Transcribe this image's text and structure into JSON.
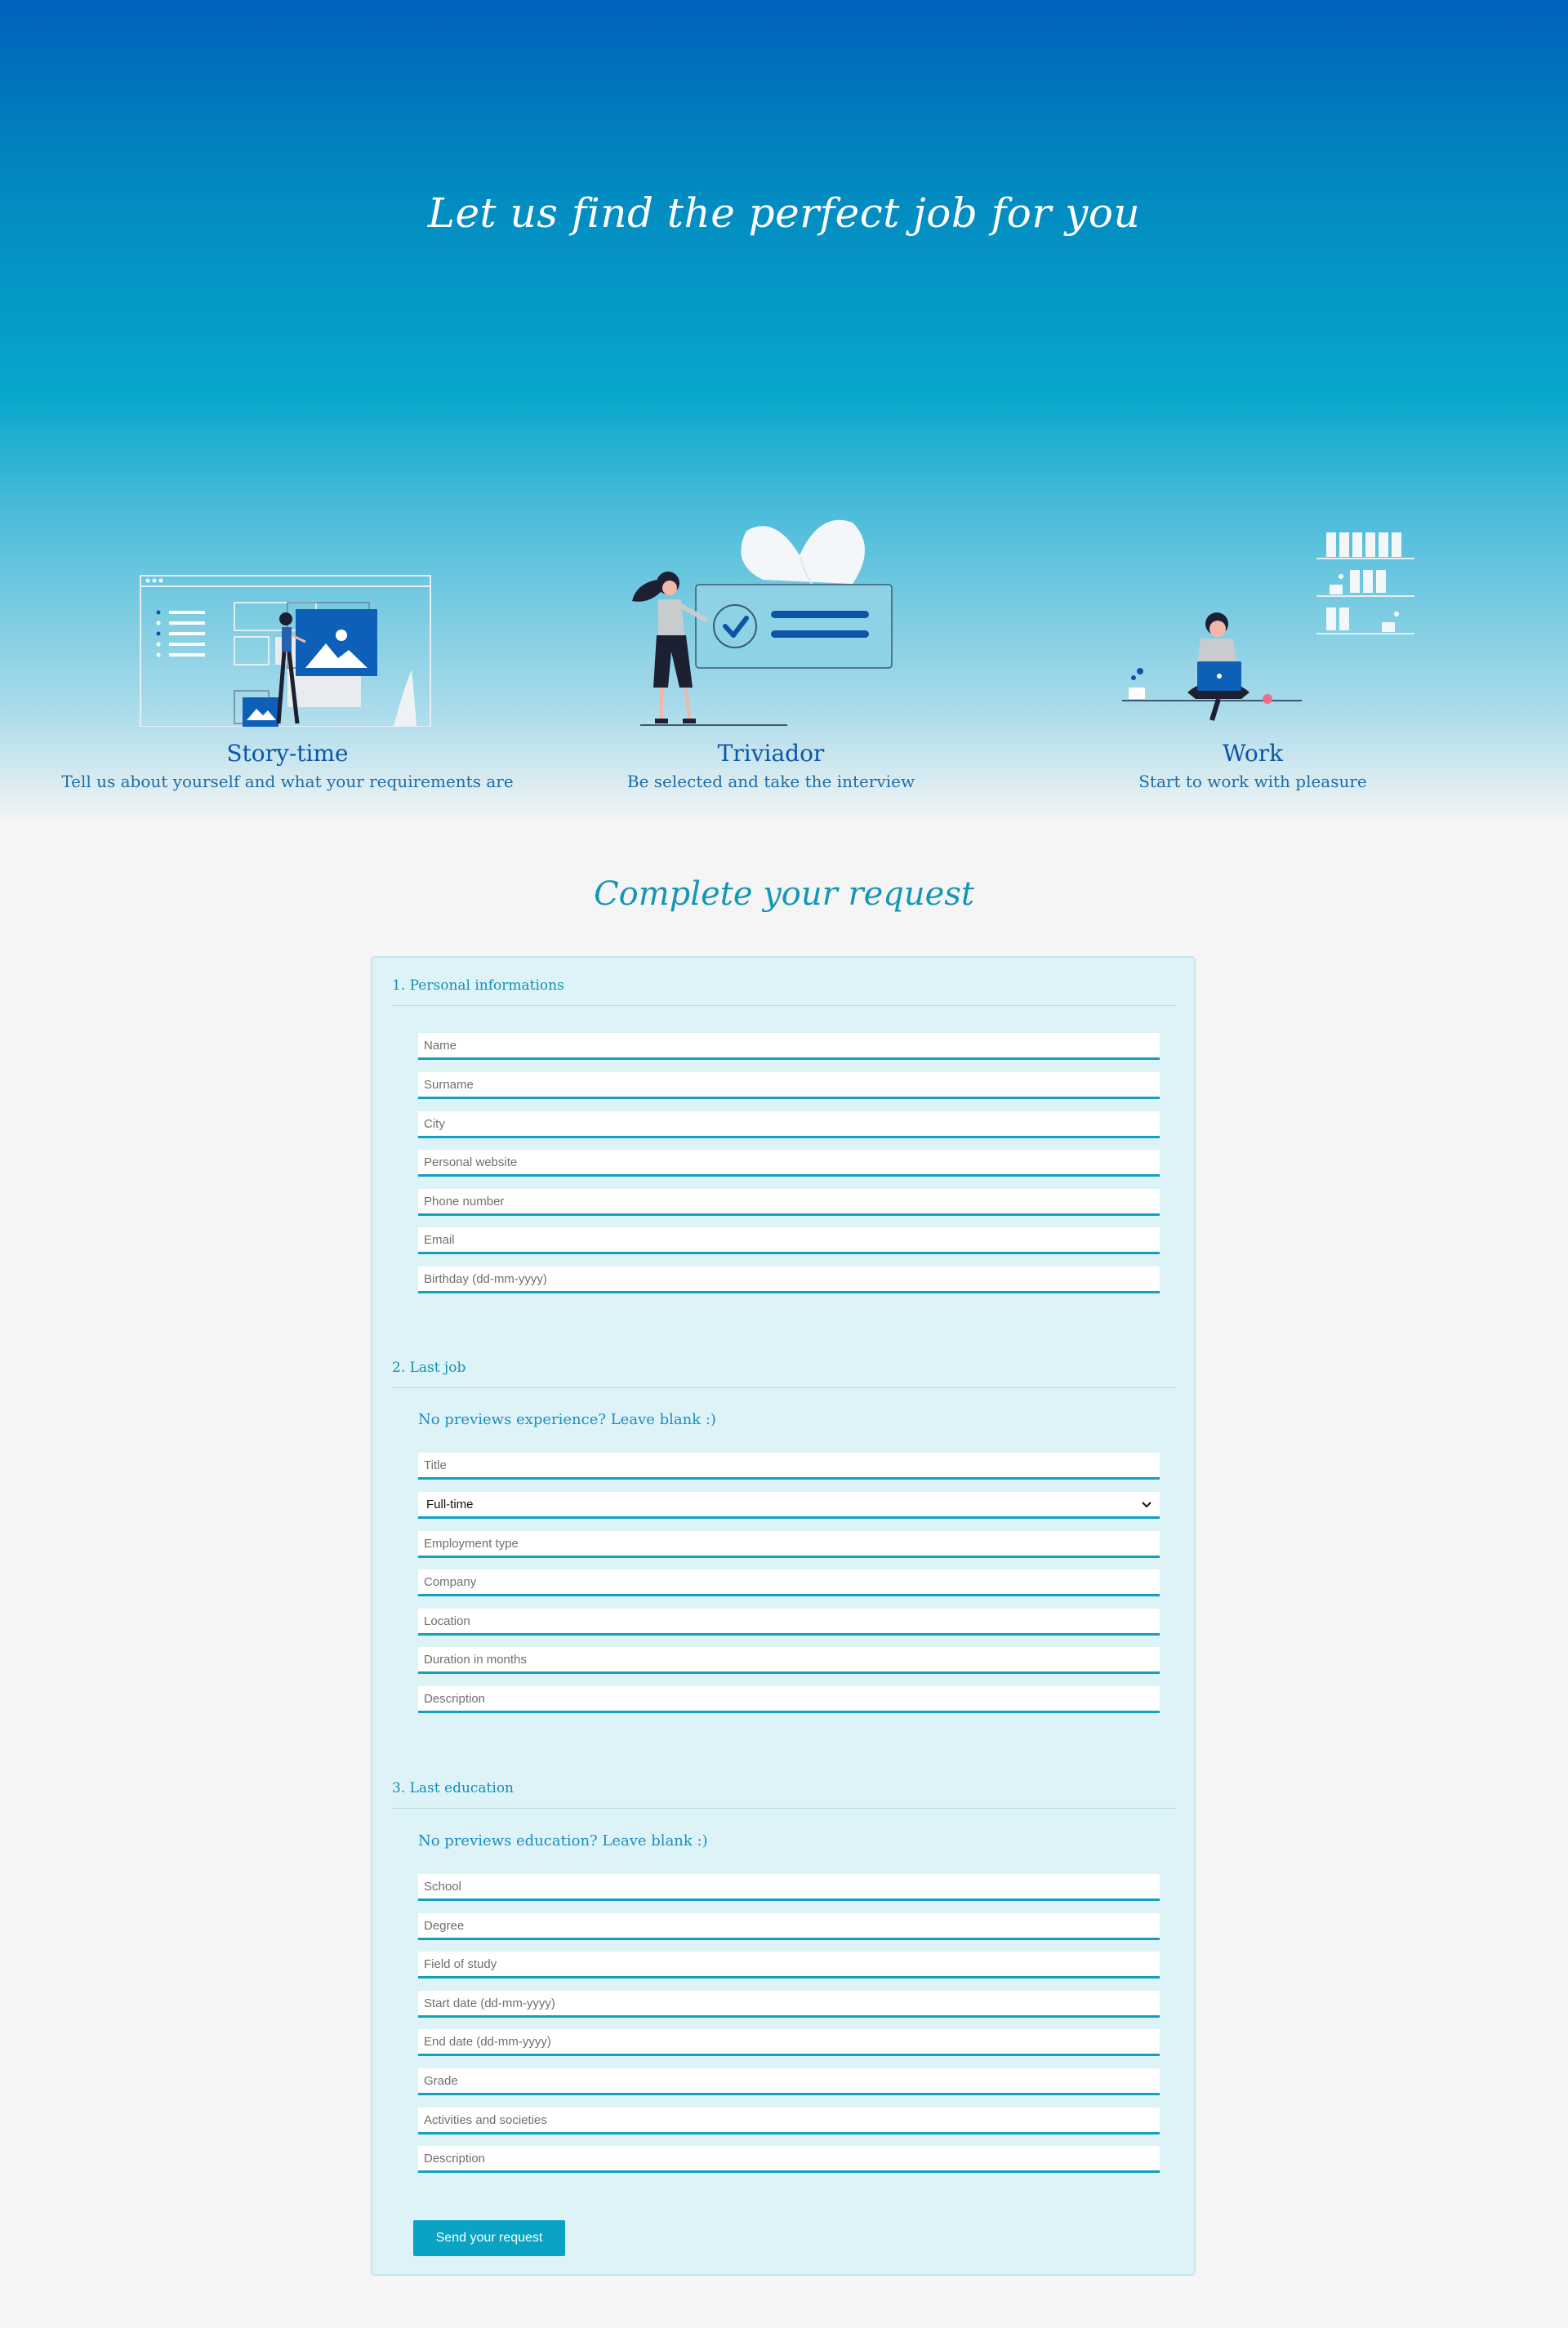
{
  "hero": {
    "title": "Let us find the perfect job for you"
  },
  "steps": [
    {
      "title": "Story-time",
      "text": "Tell us about yourself and what your requirements are",
      "icon": "browser-illustration-icon"
    },
    {
      "title": "Triviador",
      "text": "Be selected and take the interview",
      "icon": "checkmark-card-illustration-icon"
    },
    {
      "title": "Work",
      "text": "Start to work with pleasure",
      "icon": "laptop-worker-illustration-icon"
    }
  ],
  "form": {
    "heading": "Complete your request",
    "personal": {
      "title": "1. Personal informations",
      "fields": [
        "Name",
        "Surname",
        "City",
        "Personal website",
        "Phone number",
        "Email",
        "Birthday (dd-mm-yyyy)"
      ]
    },
    "job": {
      "title": "2. Last job",
      "note": "No previews experience? Leave blank :)",
      "title_field": "Title",
      "select_value": "Full-time",
      "fields": [
        "Employment type",
        "Company",
        "Location",
        "Duration in months",
        "Description"
      ]
    },
    "education": {
      "title": "3. Last education",
      "note": "No previews education? Leave blank :)",
      "fields": [
        "School",
        "Degree",
        "Field of study",
        "Start date (dd-mm-yyyy)",
        "End date (dd-mm-yyyy)",
        "Grade",
        "Activities and societies",
        "Description"
      ]
    },
    "submit_label": "Send your request"
  },
  "colors": {
    "hero_top": "#0062bb",
    "accent": "#10a1c1",
    "step_title": "#0d54a7",
    "panel_bg": "#def3f8"
  }
}
